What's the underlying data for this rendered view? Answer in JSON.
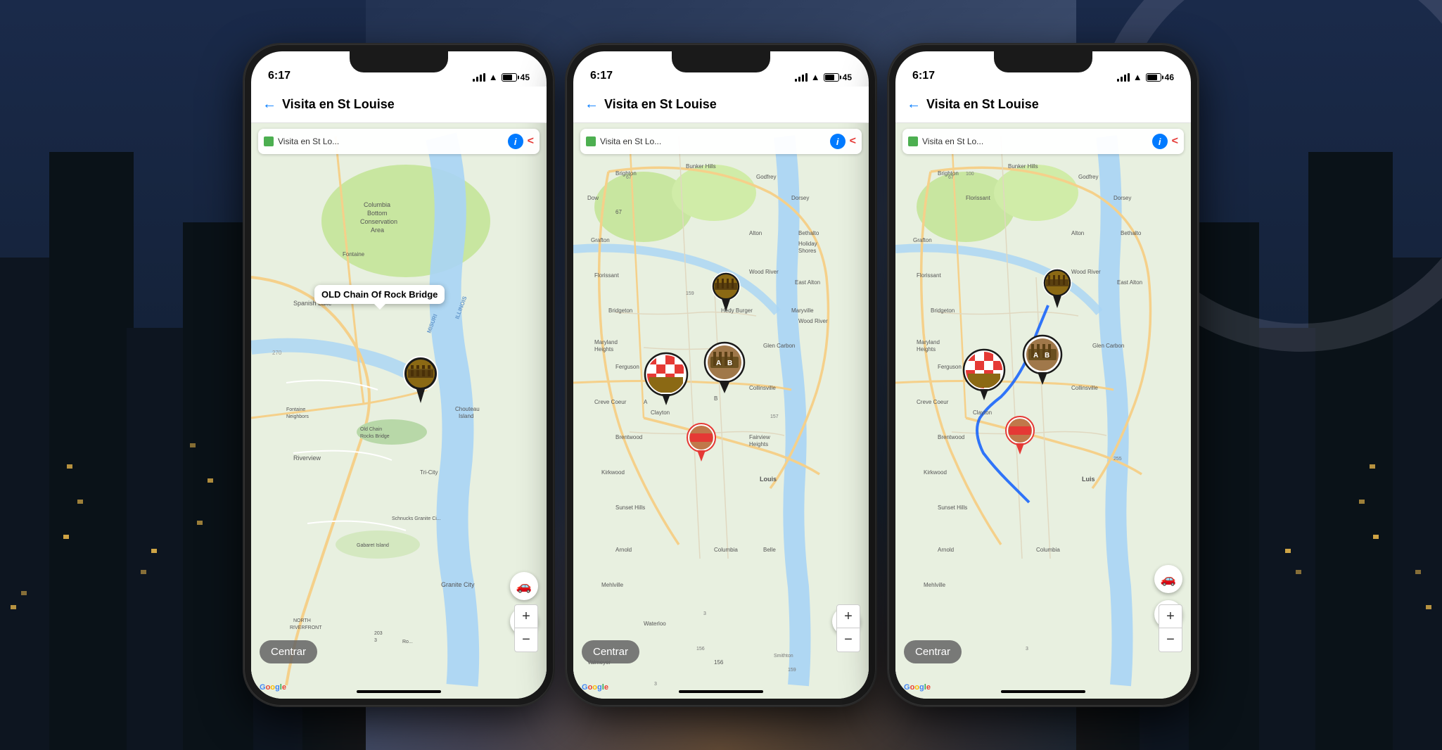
{
  "background": {
    "color": "#1a2a4a"
  },
  "phones": [
    {
      "id": "phone-1",
      "status_bar": {
        "time": "6:17",
        "signal": "●●●",
        "wifi": "WiFi",
        "battery": "45"
      },
      "nav": {
        "back_label": "←",
        "title": "Visita en St Louise"
      },
      "map_toolbar": {
        "color_label": "Visita en St Lo...",
        "info_label": "i",
        "chevron_label": "<"
      },
      "map": {
        "type": "zoomed-in",
        "callout": "OLD Chain Of Rock Bridge",
        "centrar_label": "Centrar",
        "google_label": "Google"
      },
      "zoom_controls": {
        "plus": "+",
        "minus": "−"
      }
    },
    {
      "id": "phone-2",
      "status_bar": {
        "time": "6:17",
        "signal": "●●●",
        "wifi": "WiFi",
        "battery": "45"
      },
      "nav": {
        "back_label": "←",
        "title": "Visita en St Louise"
      },
      "map_toolbar": {
        "color_label": "Visita en St Lo...",
        "info_label": "i",
        "chevron_label": "<"
      },
      "map": {
        "type": "zoomed-out",
        "centrar_label": "Centrar",
        "google_label": "Google"
      },
      "zoom_controls": {
        "plus": "+",
        "minus": "−"
      }
    },
    {
      "id": "phone-3",
      "status_bar": {
        "time": "6:17",
        "signal": "●●●",
        "wifi": "WiFi",
        "battery": "46"
      },
      "nav": {
        "back_label": "←",
        "title": "Visita en St Louise"
      },
      "map_toolbar": {
        "color_label": "Visita en St Lo...",
        "info_label": "i",
        "chevron_label": "<"
      },
      "map": {
        "type": "zoomed-out-route",
        "centrar_label": "Centrar",
        "google_label": "Google"
      },
      "zoom_controls": {
        "plus": "+",
        "minus": "−"
      }
    }
  ]
}
